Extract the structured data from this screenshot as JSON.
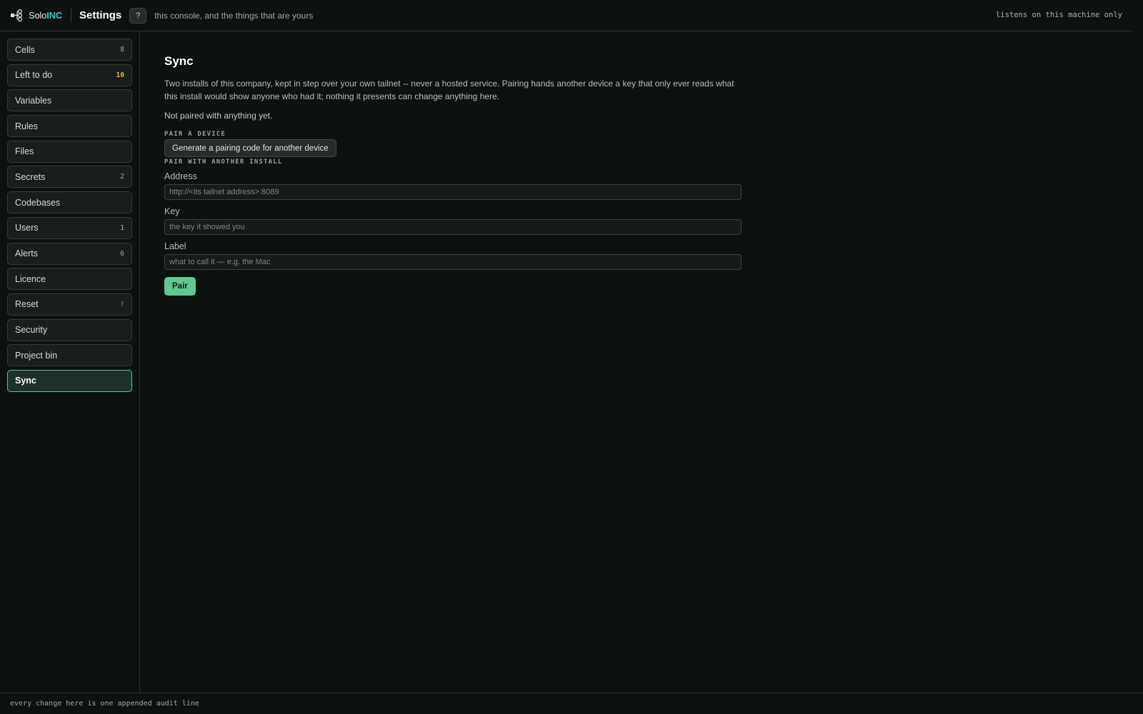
{
  "header": {
    "brand_prefix": "Solo",
    "brand_accent": "INC",
    "title": "Settings",
    "help_label": "?",
    "tagline": "this console, and the things that are yours",
    "listen_note": "listens on this machine only"
  },
  "sidebar": {
    "items": [
      {
        "label": "Cells",
        "badge": "8"
      },
      {
        "label": "Left to do",
        "badge": "10"
      },
      {
        "label": "Variables",
        "badge": ""
      },
      {
        "label": "Rules",
        "badge": ""
      },
      {
        "label": "Files",
        "badge": ""
      },
      {
        "label": "Secrets",
        "badge": "2"
      },
      {
        "label": "Codebases",
        "badge": ""
      },
      {
        "label": "Users",
        "badge": "1"
      },
      {
        "label": "Alerts",
        "badge": "6"
      },
      {
        "label": "Licence",
        "badge": ""
      },
      {
        "label": "Reset",
        "badge": "!"
      },
      {
        "label": "Security",
        "badge": ""
      },
      {
        "label": "Project bin",
        "badge": ""
      },
      {
        "label": "Sync",
        "badge": ""
      }
    ],
    "active": "Sync"
  },
  "main": {
    "title": "Sync",
    "description": "Two installs of this company, kept in step over your own tailnet -- never a hosted service. Pairing hands another device a key that only ever reads what this install would show anyone who had it; nothing it presents can change anything here.",
    "status": "Not paired with anything yet.",
    "pair_device_label": "PAIR A DEVICE",
    "generate_button": "Generate a pairing code for another device",
    "pair_install_label": "PAIR WITH ANOTHER INSTALL",
    "fields": {
      "address": {
        "label": "Address",
        "placeholder": "http://<its tailnet address>:8089",
        "value": ""
      },
      "key": {
        "label": "Key",
        "placeholder": "the key it showed you",
        "value": ""
      },
      "label": {
        "label": "Label",
        "placeholder": "what to call it — e.g. the Mac",
        "value": ""
      }
    },
    "pair_button": "Pair"
  },
  "footer": {
    "note": "every change here is one appended audit line"
  },
  "colors": {
    "background": "#0c1210",
    "brand_accent": "#2fc4cf",
    "active_border": "#58c48c",
    "primary_button": "#5fc98f",
    "badge_warn": "#e8b44a",
    "badge_alert": "#ef5a3c"
  }
}
